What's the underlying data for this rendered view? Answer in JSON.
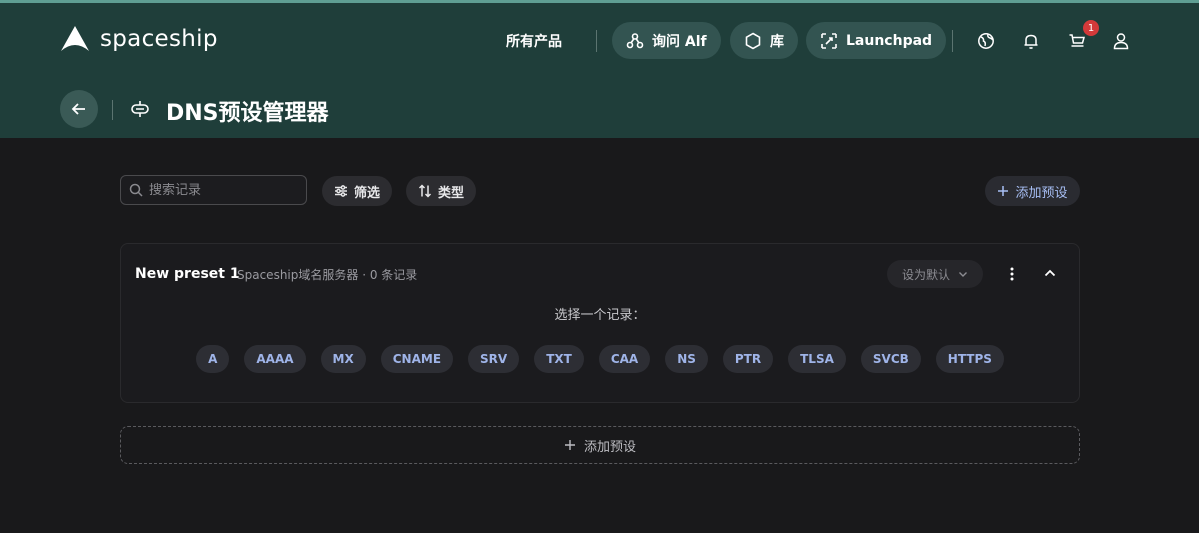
{
  "header": {
    "brand": "spaceship",
    "all_products": "所有产品",
    "ask_alf": "询问 Alf",
    "library": "库",
    "launchpad": "Launchpad",
    "cart_count": "1",
    "icons": [
      "globe-icon",
      "bell-icon",
      "cart-icon",
      "user-icon"
    ]
  },
  "page": {
    "title": "DNS预设管理器"
  },
  "toolbar": {
    "search_placeholder": "搜索记录",
    "filter": "筛选",
    "sort": "类型",
    "add_preset": "添加预设"
  },
  "preset": {
    "name": "New preset 1",
    "meta": "Spaceship域名服务器 · 0 条记录",
    "default_label": "设为默认",
    "choose_label": "选择一个记录：",
    "record_types": [
      "A",
      "AAAA",
      "MX",
      "CNAME",
      "SRV",
      "TXT",
      "CAA",
      "NS",
      "PTR",
      "TLSA",
      "SVCB",
      "HTTPS"
    ]
  },
  "footer": {
    "add_preset": "添加预设"
  },
  "colors": {
    "header_bg": "#1f3e3a",
    "page_bg": "#19191b",
    "accent": "#a8bff5",
    "badge": "#d33a3a"
  }
}
